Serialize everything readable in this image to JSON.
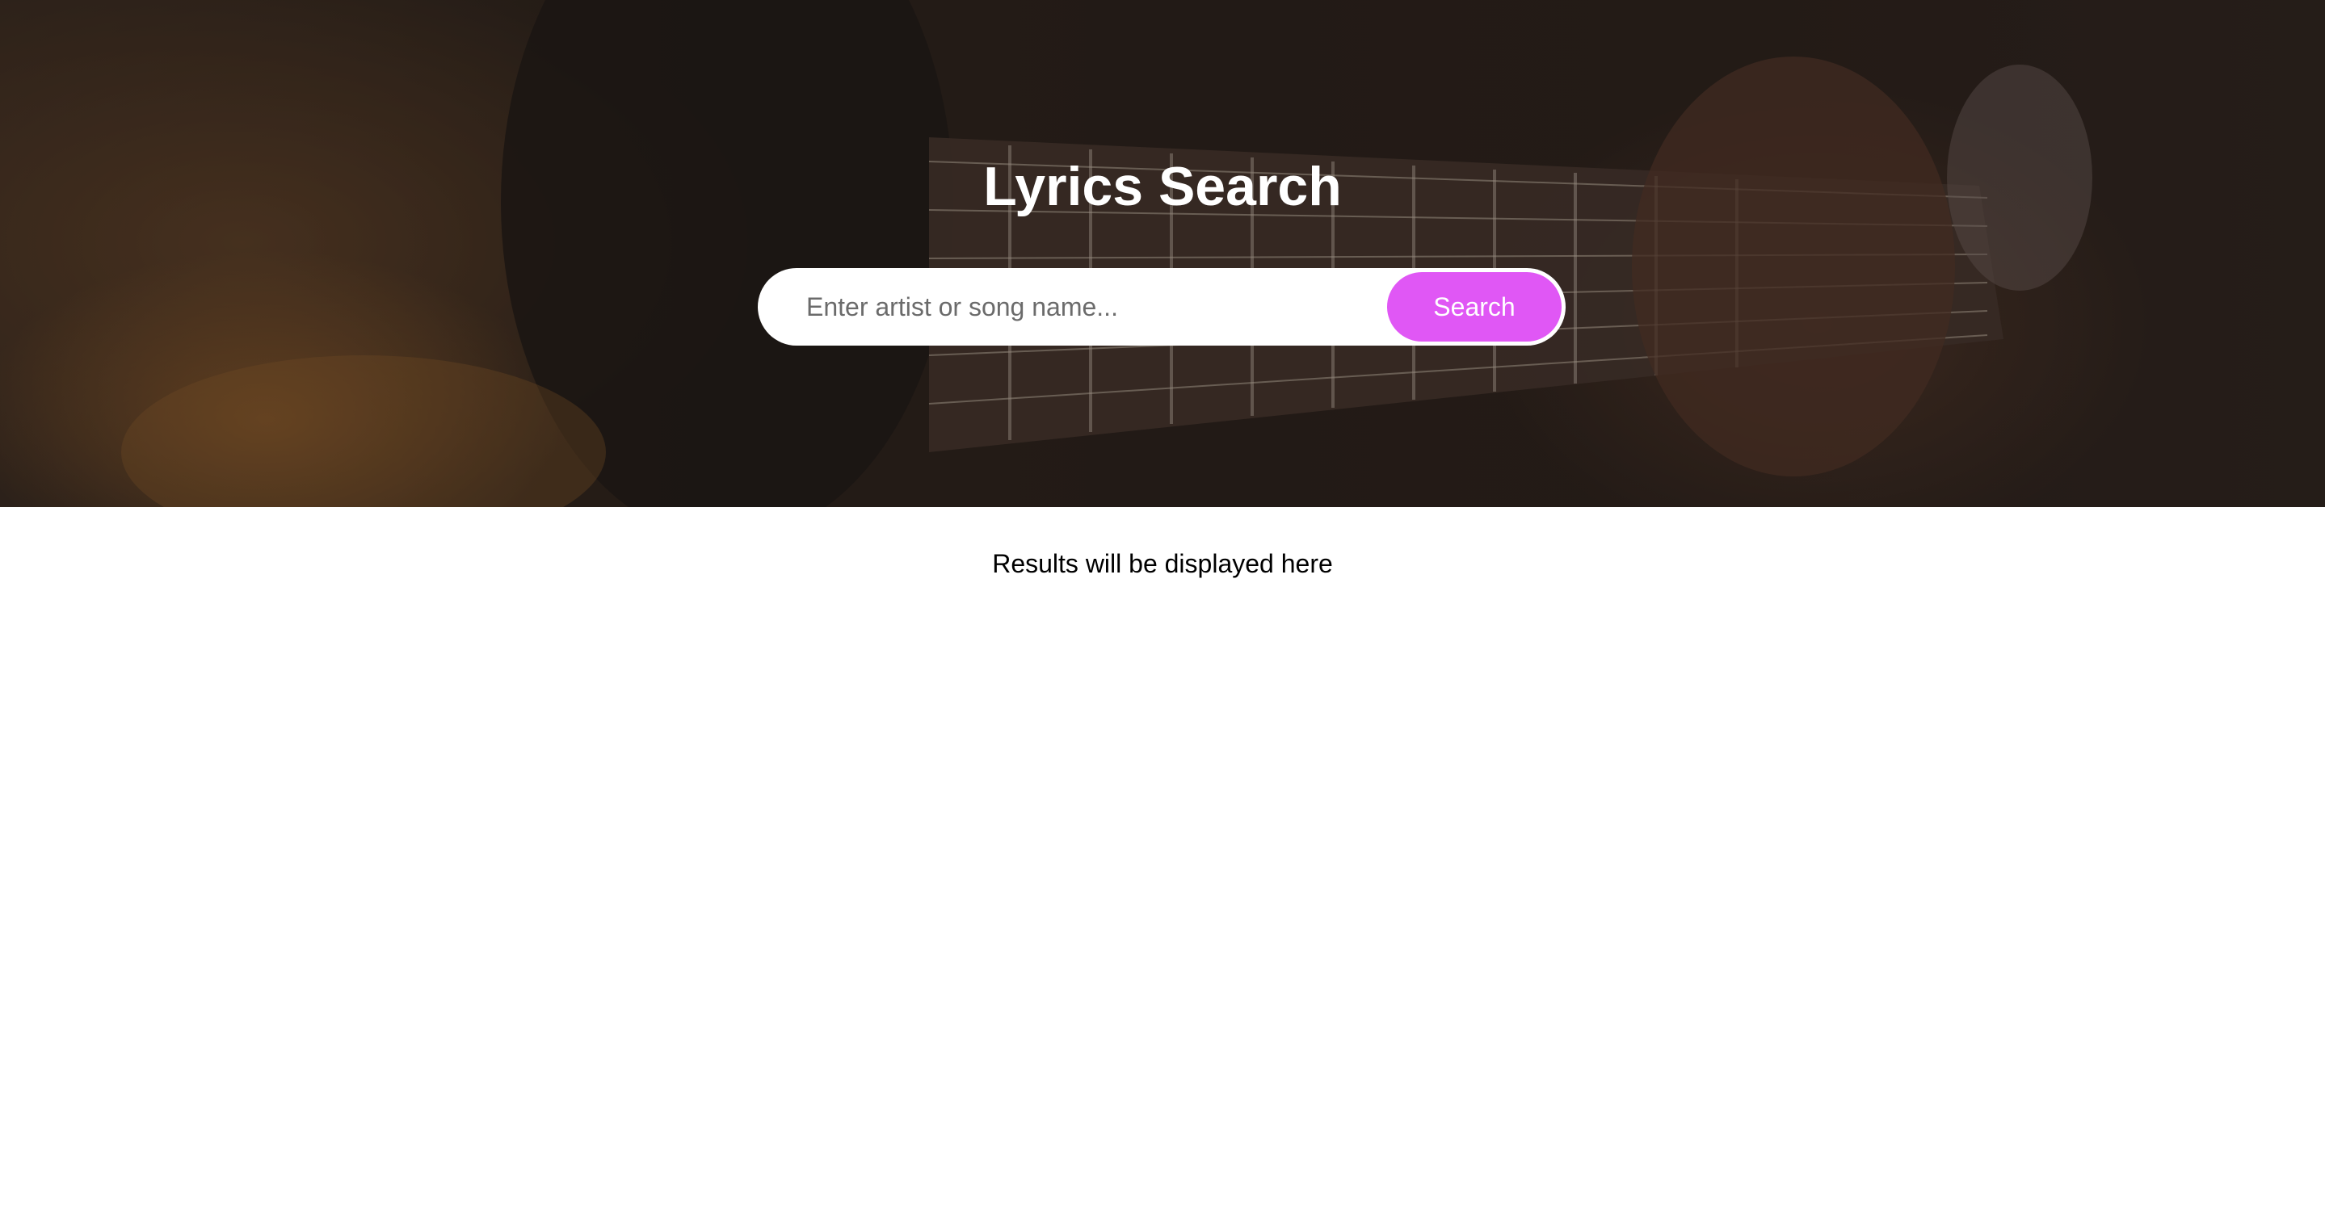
{
  "hero": {
    "title": "Lyrics Search",
    "background_image": "guitar-fretboard-photo"
  },
  "search": {
    "placeholder": "Enter artist or song name...",
    "value": "",
    "button_label": "Search",
    "button_color": "#e057f5"
  },
  "results": {
    "message": "Results will be displayed here"
  }
}
